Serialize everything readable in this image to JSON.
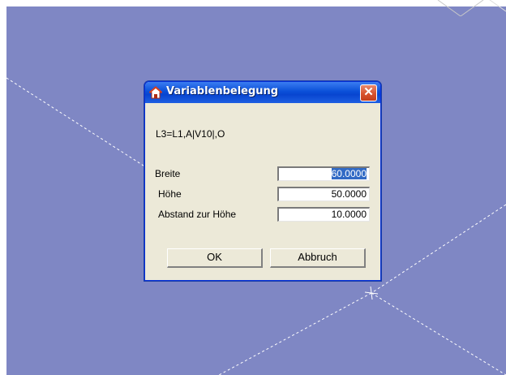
{
  "dialog": {
    "title": "Variablenbelegung",
    "close_symbol": "✕",
    "icon": "house-icon",
    "formula": "L3=L1,A|V10|,O",
    "fields": [
      {
        "label": "Breite",
        "value": "60.0000",
        "selected": true
      },
      {
        "label": "Höhe",
        "value": "50.0000",
        "selected": false
      },
      {
        "label": "Abstand zur Höhe",
        "value": "10.0000",
        "selected": false
      }
    ],
    "buttons": {
      "ok": "OK",
      "cancel": "Abbruch"
    }
  },
  "colors": {
    "workspace": "#7f87c4",
    "dialog_bg": "#ece9d8",
    "titlebar": "#0a4fd8",
    "selection": "#316ac5"
  }
}
